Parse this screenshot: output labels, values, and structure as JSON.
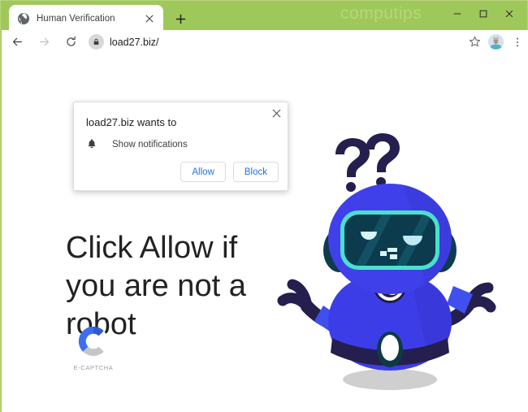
{
  "window": {
    "watermark": "computips",
    "accent_green": "#9fc85a",
    "controls": [
      {
        "name": "minimize-button",
        "glyph": "minimize"
      },
      {
        "name": "maximize-button",
        "glyph": "maximize"
      },
      {
        "name": "close-button",
        "glyph": "close"
      }
    ]
  },
  "tabstrip": {
    "tab_title": "Human Verification",
    "favicon": "globe-icon",
    "close_icon": "close-icon",
    "new_tab_icon": "plus-icon"
  },
  "toolbar": {
    "back_icon": "arrow-left-icon",
    "forward_icon": "arrow-right-icon",
    "reload_icon": "reload-icon",
    "lock_icon": "lock-icon",
    "url": "load27.biz/",
    "bookmark_icon": "star-icon",
    "avatar_icon": "profile-avatar",
    "menu_icon": "three-dot-menu-icon"
  },
  "permission_dialog": {
    "title": "load27.biz wants to",
    "permission_icon": "bell-icon",
    "permission_label": "Show notifications",
    "allow_label": "Allow",
    "block_label": "Block",
    "close_icon": "close-icon",
    "link_color": "#1a73e8"
  },
  "page": {
    "headline": "Click Allow if you are not a robot",
    "captcha_brand": "E-CAPTCHA",
    "captcha_logo": "c-ring-logo",
    "mascot": "confused-robot-illustration",
    "mascot_colors": {
      "body": "#4040e0",
      "body_dark": "#1f1f4d",
      "screen": "#0b3b4d",
      "screen_border": "#4ae0d0",
      "shadow": "#cfcfcf"
    }
  }
}
